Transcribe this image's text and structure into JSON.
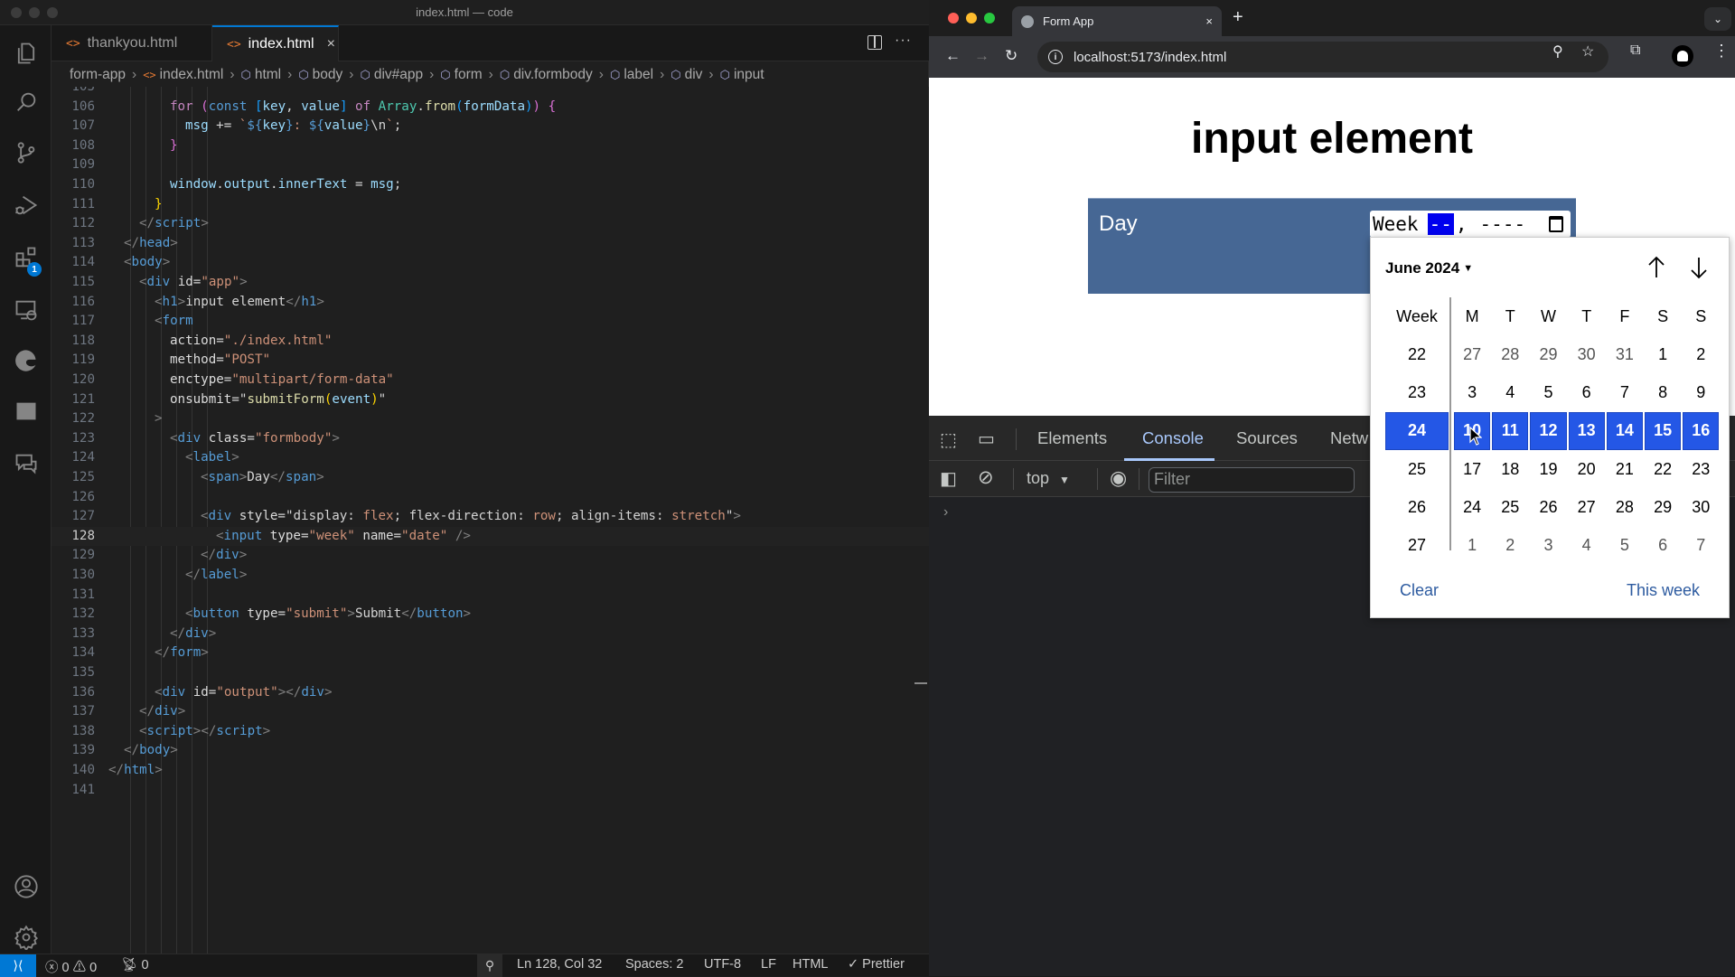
{
  "vscode": {
    "window_title": "index.html — code",
    "activity_bar": [
      {
        "name": "explorer-icon"
      },
      {
        "name": "search-icon"
      },
      {
        "name": "source-control-icon"
      },
      {
        "name": "run-debug-icon"
      },
      {
        "name": "extensions-icon",
        "badge": "1"
      },
      {
        "name": "remote-explorer-icon"
      },
      {
        "name": "edge-devtools-icon"
      },
      {
        "name": "image-preview-icon"
      },
      {
        "name": "chat-icon"
      }
    ],
    "activity_bar_bottom": [
      {
        "name": "account-icon"
      },
      {
        "name": "settings-gear-icon"
      }
    ],
    "tabs": [
      {
        "label": "thankyou.html",
        "active": false
      },
      {
        "label": "index.html",
        "active": true,
        "close": "×"
      }
    ],
    "breadcrumb": [
      "form-app",
      "index.html",
      "html",
      "body",
      "div#app",
      "form",
      "div.formbody",
      "label",
      "div",
      "input"
    ],
    "current_line": 128,
    "code_lines": [
      {
        "n": "105",
        "indent": 4,
        "tokens": []
      },
      {
        "n": "106",
        "indent": 4,
        "tokens": [
          [
            "t-kw",
            "for "
          ],
          [
            "t-p",
            "("
          ],
          [
            "t-cst",
            "const "
          ],
          [
            "t-b",
            "["
          ],
          [
            "t-var",
            "key"
          ],
          [
            "t-txt",
            ", "
          ],
          [
            "t-var",
            "value"
          ],
          [
            "t-b",
            "]"
          ],
          [
            "t-kw",
            " of "
          ],
          [
            "t-cls",
            "Array"
          ],
          [
            "t-txt",
            "."
          ],
          [
            "t-fn",
            "from"
          ],
          [
            "t-b",
            "("
          ],
          [
            "t-var",
            "formData"
          ],
          [
            "t-b",
            ")"
          ],
          [
            "t-p",
            ")"
          ],
          [
            "t-txt",
            " "
          ],
          [
            "t-p",
            "{"
          ]
        ]
      },
      {
        "n": "107",
        "indent": 5,
        "tokens": [
          [
            "t-var",
            "msg"
          ],
          [
            "t-txt",
            " += "
          ],
          [
            "t-str",
            "`"
          ],
          [
            "t-cst",
            "${"
          ],
          [
            "t-var",
            "key"
          ],
          [
            "t-cst",
            "}"
          ],
          [
            "t-str",
            ": "
          ],
          [
            "t-cst",
            "${"
          ],
          [
            "t-var",
            "value"
          ],
          [
            "t-cst",
            "}"
          ],
          [
            "t-txt",
            "\\n"
          ],
          [
            "t-str",
            "`"
          ],
          [
            "t-txt",
            ";"
          ]
        ]
      },
      {
        "n": "108",
        "indent": 4,
        "tokens": [
          [
            "t-p",
            "}"
          ]
        ]
      },
      {
        "n": "109",
        "indent": 4,
        "tokens": []
      },
      {
        "n": "110",
        "indent": 4,
        "tokens": [
          [
            "t-var",
            "window"
          ],
          [
            "t-txt",
            "."
          ],
          [
            "t-var",
            "output"
          ],
          [
            "t-txt",
            "."
          ],
          [
            "t-var",
            "innerText"
          ],
          [
            "t-txt",
            " = "
          ],
          [
            "t-var",
            "msg"
          ],
          [
            "t-txt",
            ";"
          ]
        ]
      },
      {
        "n": "111",
        "indent": 3,
        "tokens": [
          [
            "t-y",
            "}"
          ]
        ]
      },
      {
        "n": "112",
        "indent": 2,
        "tokens": [
          [
            "t-br",
            "</"
          ],
          [
            "t-tag",
            "script"
          ],
          [
            "t-br",
            ">"
          ]
        ]
      },
      {
        "n": "113",
        "indent": 1,
        "tokens": [
          [
            "t-br",
            "</"
          ],
          [
            "t-tag",
            "head"
          ],
          [
            "t-br",
            ">"
          ]
        ]
      },
      {
        "n": "114",
        "indent": 1,
        "tokens": [
          [
            "t-br",
            "<"
          ],
          [
            "t-tag",
            "body"
          ],
          [
            "t-br",
            ">"
          ]
        ]
      },
      {
        "n": "115",
        "indent": 2,
        "tokens": [
          [
            "t-br",
            "<"
          ],
          [
            "t-tag",
            "div"
          ],
          [
            "t-attrw",
            " id"
          ],
          [
            "t-txt",
            "="
          ],
          [
            "t-str",
            "\"app\""
          ],
          [
            "t-br",
            ">"
          ]
        ]
      },
      {
        "n": "116",
        "indent": 3,
        "tokens": [
          [
            "t-br",
            "<"
          ],
          [
            "t-tag",
            "h1"
          ],
          [
            "t-br",
            ">"
          ],
          [
            "t-txt",
            "input element"
          ],
          [
            "t-br",
            "</"
          ],
          [
            "t-tag",
            "h1"
          ],
          [
            "t-br",
            ">"
          ]
        ]
      },
      {
        "n": "117",
        "indent": 3,
        "tokens": [
          [
            "t-br",
            "<"
          ],
          [
            "t-tag",
            "form"
          ]
        ]
      },
      {
        "n": "118",
        "indent": 4,
        "tokens": [
          [
            "t-attrw",
            "action"
          ],
          [
            "t-txt",
            "="
          ],
          [
            "t-str",
            "\"./index.html\""
          ]
        ]
      },
      {
        "n": "119",
        "indent": 4,
        "tokens": [
          [
            "t-attrw",
            "method"
          ],
          [
            "t-txt",
            "="
          ],
          [
            "t-str",
            "\"POST\""
          ]
        ]
      },
      {
        "n": "120",
        "indent": 4,
        "tokens": [
          [
            "t-attrw",
            "enctype"
          ],
          [
            "t-txt",
            "="
          ],
          [
            "t-str",
            "\"multipart/form-data\""
          ]
        ]
      },
      {
        "n": "121",
        "indent": 4,
        "tokens": [
          [
            "t-attrw",
            "onsubmit"
          ],
          [
            "t-txt",
            "=\""
          ],
          [
            "t-fn",
            "submitForm"
          ],
          [
            "t-y",
            "("
          ],
          [
            "t-var",
            "event"
          ],
          [
            "t-y",
            ")"
          ],
          [
            "t-txt",
            "\""
          ]
        ]
      },
      {
        "n": "122",
        "indent": 3,
        "tokens": [
          [
            "t-br",
            ">"
          ]
        ]
      },
      {
        "n": "123",
        "indent": 4,
        "tokens": [
          [
            "t-br",
            "<"
          ],
          [
            "t-tag",
            "div"
          ],
          [
            "t-attrw",
            " class"
          ],
          [
            "t-txt",
            "="
          ],
          [
            "t-str",
            "\"formbody\""
          ],
          [
            "t-br",
            ">"
          ]
        ]
      },
      {
        "n": "124",
        "indent": 5,
        "tokens": [
          [
            "t-br",
            "<"
          ],
          [
            "t-tag",
            "label"
          ],
          [
            "t-br",
            ">"
          ]
        ]
      },
      {
        "n": "125",
        "indent": 6,
        "tokens": [
          [
            "t-br",
            "<"
          ],
          [
            "t-tag",
            "span"
          ],
          [
            "t-br",
            ">"
          ],
          [
            "t-txt",
            "Day"
          ],
          [
            "t-br",
            "</"
          ],
          [
            "t-tag",
            "span"
          ],
          [
            "t-br",
            ">"
          ]
        ]
      },
      {
        "n": "126",
        "indent": 6,
        "tokens": []
      },
      {
        "n": "127",
        "indent": 6,
        "tokens": [
          [
            "t-br",
            "<"
          ],
          [
            "t-tag",
            "div"
          ],
          [
            "t-attrw",
            " style"
          ],
          [
            "t-txt",
            "=\"display: "
          ],
          [
            "t-str",
            "flex"
          ],
          [
            "t-txt",
            "; flex-direction: "
          ],
          [
            "t-str",
            "row"
          ],
          [
            "t-txt",
            "; align-items: "
          ],
          [
            "t-str",
            "stretch"
          ],
          [
            "t-txt",
            "\""
          ],
          [
            "t-br",
            ">"
          ]
        ]
      },
      {
        "n": "128",
        "indent": 7,
        "tokens": [
          [
            "t-br",
            "<"
          ],
          [
            "t-tag",
            "input"
          ],
          [
            "t-attrw",
            " type"
          ],
          [
            "t-txt",
            "="
          ],
          [
            "t-str",
            "\"week\""
          ],
          [
            "t-attrw",
            " name"
          ],
          [
            "t-txt",
            "="
          ],
          [
            "t-str",
            "\"date\""
          ],
          [
            "t-br",
            " />"
          ]
        ]
      },
      {
        "n": "129",
        "indent": 6,
        "tokens": [
          [
            "t-br",
            "</"
          ],
          [
            "t-tag",
            "div"
          ],
          [
            "t-br",
            ">"
          ]
        ]
      },
      {
        "n": "130",
        "indent": 5,
        "tokens": [
          [
            "t-br",
            "</"
          ],
          [
            "t-tag",
            "label"
          ],
          [
            "t-br",
            ">"
          ]
        ]
      },
      {
        "n": "131",
        "indent": 5,
        "tokens": []
      },
      {
        "n": "132",
        "indent": 5,
        "tokens": [
          [
            "t-br",
            "<"
          ],
          [
            "t-tag",
            "button"
          ],
          [
            "t-attrw",
            " type"
          ],
          [
            "t-txt",
            "="
          ],
          [
            "t-str",
            "\"submit\""
          ],
          [
            "t-br",
            ">"
          ],
          [
            "t-txt",
            "Submit"
          ],
          [
            "t-br",
            "</"
          ],
          [
            "t-tag",
            "button"
          ],
          [
            "t-br",
            ">"
          ]
        ]
      },
      {
        "n": "133",
        "indent": 4,
        "tokens": [
          [
            "t-br",
            "</"
          ],
          [
            "t-tag",
            "div"
          ],
          [
            "t-br",
            ">"
          ]
        ]
      },
      {
        "n": "134",
        "indent": 3,
        "tokens": [
          [
            "t-br",
            "</"
          ],
          [
            "t-tag",
            "form"
          ],
          [
            "t-br",
            ">"
          ]
        ]
      },
      {
        "n": "135",
        "indent": 3,
        "tokens": []
      },
      {
        "n": "136",
        "indent": 3,
        "tokens": [
          [
            "t-br",
            "<"
          ],
          [
            "t-tag",
            "div"
          ],
          [
            "t-attrw",
            " id"
          ],
          [
            "t-txt",
            "="
          ],
          [
            "t-str",
            "\"output\""
          ],
          [
            "t-br",
            "></"
          ],
          [
            "t-tag",
            "div"
          ],
          [
            "t-br",
            ">"
          ]
        ]
      },
      {
        "n": "137",
        "indent": 2,
        "tokens": [
          [
            "t-br",
            "</"
          ],
          [
            "t-tag",
            "div"
          ],
          [
            "t-br",
            ">"
          ]
        ]
      },
      {
        "n": "138",
        "indent": 2,
        "tokens": [
          [
            "t-br",
            "<"
          ],
          [
            "t-tag",
            "script"
          ],
          [
            "t-br",
            "></"
          ],
          [
            "t-tag",
            "script"
          ],
          [
            "t-br",
            ">"
          ]
        ]
      },
      {
        "n": "139",
        "indent": 1,
        "tokens": [
          [
            "t-br",
            "</"
          ],
          [
            "t-tag",
            "body"
          ],
          [
            "t-br",
            ">"
          ]
        ]
      },
      {
        "n": "140",
        "indent": 0,
        "tokens": [
          [
            "t-br",
            "</"
          ],
          [
            "t-tag",
            "html"
          ],
          [
            "t-br",
            ">"
          ]
        ]
      },
      {
        "n": "141",
        "indent": 0,
        "tokens": []
      }
    ],
    "status_bar": {
      "errors": "0",
      "warnings": "0",
      "ports": "0",
      "cursor_position": "Ln 128, Col 32",
      "indentation": "Spaces: 2",
      "encoding": "UTF-8",
      "eol": "LF",
      "language": "HTML",
      "formatter": "✓ Prettier"
    }
  },
  "browser": {
    "tab_title": "Form App",
    "tab_close": "×",
    "new_tab": "+",
    "url": "localhost:5173/index.html",
    "page": {
      "heading": "input element",
      "label": "Day",
      "week_input": {
        "prefix": "Week",
        "week_segment": "--",
        "separator": ",",
        "year_segment": "----"
      }
    },
    "devtools": {
      "tabs": [
        {
          "label": "Elements",
          "active": false
        },
        {
          "label": "Console",
          "active": true
        },
        {
          "label": "Sources",
          "active": false
        },
        {
          "label": "Netw",
          "active": false
        }
      ],
      "context": "top",
      "filter_placeholder": "Filter",
      "prompt": "›"
    }
  },
  "week_picker": {
    "month_label": "June 2024",
    "header": [
      "Week",
      "M",
      "T",
      "W",
      "T",
      "F",
      "S",
      "S"
    ],
    "selected_week": "24",
    "rows": [
      {
        "week": "22",
        "days": [
          "27",
          "28",
          "29",
          "30",
          "31",
          "1",
          "2"
        ],
        "other_month": [
          true,
          true,
          true,
          true,
          true,
          false,
          false
        ]
      },
      {
        "week": "23",
        "days": [
          "3",
          "4",
          "5",
          "6",
          "7",
          "8",
          "9"
        ],
        "other_month": [
          false,
          false,
          false,
          false,
          false,
          false,
          false
        ]
      },
      {
        "week": "24",
        "days": [
          "10",
          "11",
          "12",
          "13",
          "14",
          "15",
          "16"
        ],
        "other_month": [
          false,
          false,
          false,
          false,
          false,
          false,
          false
        ]
      },
      {
        "week": "25",
        "days": [
          "17",
          "18",
          "19",
          "20",
          "21",
          "22",
          "23"
        ],
        "other_month": [
          false,
          false,
          false,
          false,
          false,
          false,
          false
        ]
      },
      {
        "week": "26",
        "days": [
          "24",
          "25",
          "26",
          "27",
          "28",
          "29",
          "30"
        ],
        "other_month": [
          false,
          false,
          false,
          false,
          false,
          false,
          false
        ]
      },
      {
        "week": "27",
        "days": [
          "1",
          "2",
          "3",
          "4",
          "5",
          "6",
          "7"
        ],
        "other_month": [
          true,
          true,
          true,
          true,
          true,
          true,
          true
        ]
      }
    ],
    "clear_label": "Clear",
    "this_week_label": "This week",
    "selection_color": "#2457e6"
  }
}
